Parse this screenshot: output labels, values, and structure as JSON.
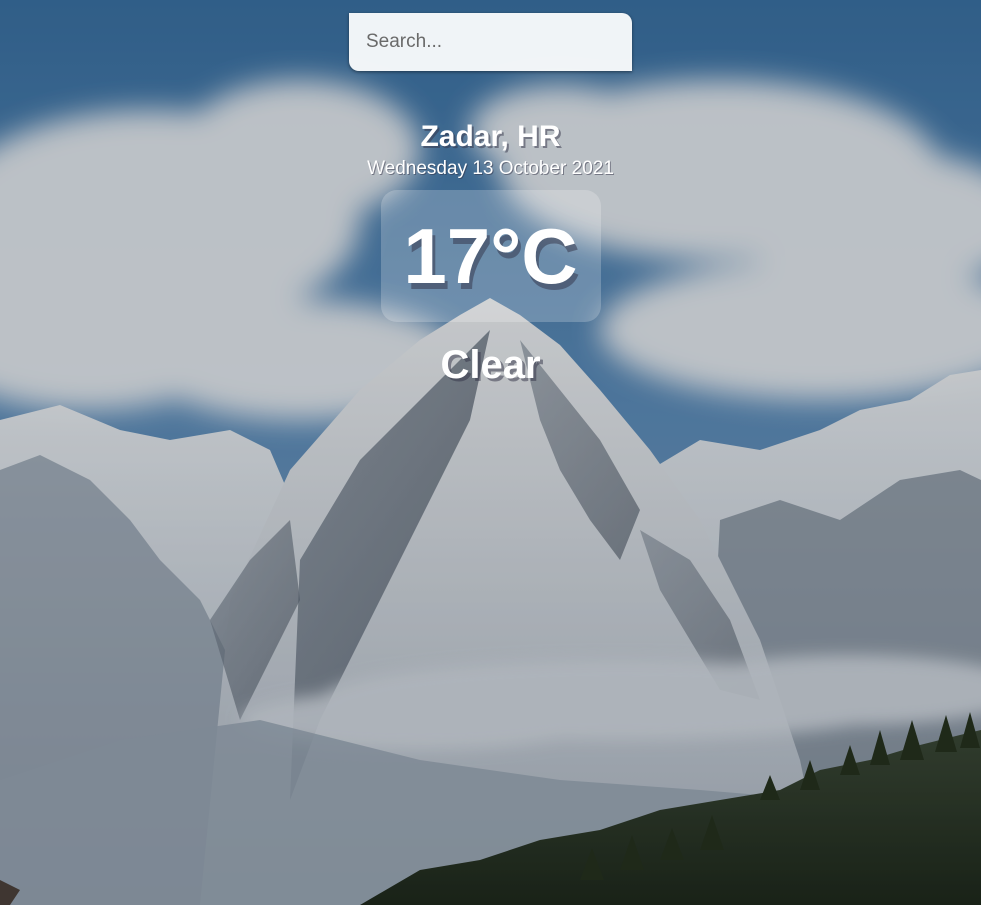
{
  "search": {
    "placeholder": "Search...",
    "value": ""
  },
  "location": {
    "city": "Zadar, HR",
    "date": "Wednesday 13 October 2021"
  },
  "weather": {
    "temperature": "17°C",
    "condition": "Clear"
  },
  "background": {
    "scene": "snowy-mountain-landscape",
    "sky_color": "#4a7fb0",
    "cloud_color": "#e8eef3",
    "rock_color": "#5d6a78",
    "forest_color": "#2d3a2a"
  }
}
